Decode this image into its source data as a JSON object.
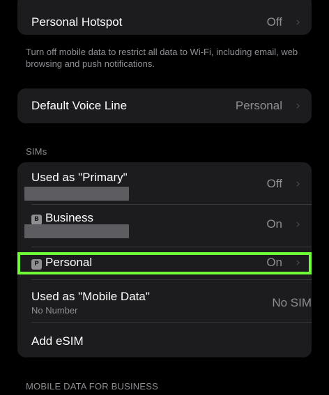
{
  "hotspot": {
    "label": "Personal Hotspot",
    "value": "Off"
  },
  "mobile_data_footnote": "Turn off mobile data to restrict all data to Wi-Fi, including email, web browsing and push notifications.",
  "voice_line": {
    "label": "Default Voice Line",
    "value": "Personal"
  },
  "sims": {
    "header": "SIMs",
    "primary": {
      "label": "Used as \"Primary\"",
      "value": "Off"
    },
    "business": {
      "badge": "B",
      "label": "Business",
      "value": "On"
    },
    "personal": {
      "badge": "P",
      "label": "Personal",
      "value": "On"
    },
    "mobile_data": {
      "label": "Used as \"Mobile Data\"",
      "sublabel": "No Number",
      "value": "No SIM"
    },
    "add_esim": "Add eSIM"
  },
  "business_section_header": "MOBILE DATA FOR BUSINESS",
  "chevron": "›",
  "colors": {
    "accent": "#0a84ff",
    "highlight": "#6eff37",
    "cell": "#1c1c1e"
  }
}
